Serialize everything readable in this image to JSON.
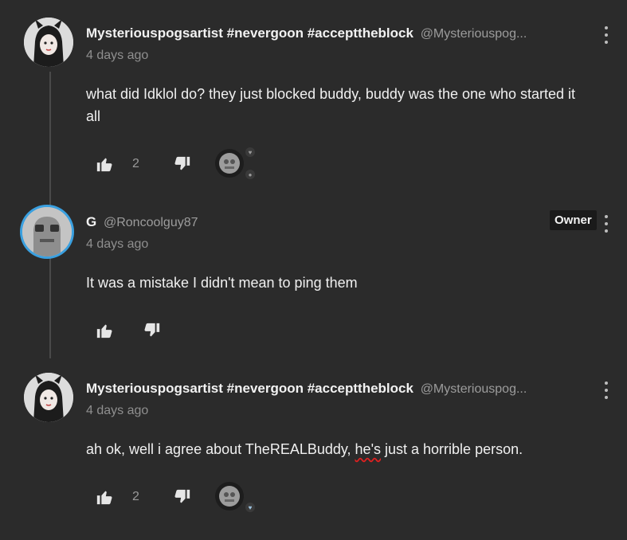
{
  "comments": [
    {
      "author": "Mysteriouspogsartist #nevergoon #accepttheblock",
      "handle": "@Mysteriouspog...",
      "time": "4 days ago",
      "text": "what did Idklol do? they just blocked buddy, buddy was the one who started it all",
      "likes": "2",
      "badge": ""
    },
    {
      "author": "G",
      "handle": "@Roncoolguy87",
      "time": "4 days ago",
      "text": "It was a mistake I didn't mean to ping them",
      "likes": "",
      "badge": "Owner"
    },
    {
      "author": "Mysteriouspogsartist #nevergoon #accepttheblock",
      "handle": "@Mysteriouspog...",
      "time": "4 days ago",
      "text_before": "ah ok, well i agree about TheREALBuddy, ",
      "text_underlined": "he's",
      "text_after": " just a horrible person.",
      "likes": "2",
      "badge": ""
    }
  ],
  "icons": {
    "like": "thumbs-up-icon",
    "dislike": "thumbs-down-icon",
    "menu": "kebab-menu-icon",
    "heart": "heart-icon",
    "reply": "reply-bubble-icon"
  },
  "colors": {
    "background": "#2b2b2b",
    "text": "#f0f0f0",
    "muted": "#8f8f8f",
    "avatar_ring": "#3aa0e0"
  }
}
